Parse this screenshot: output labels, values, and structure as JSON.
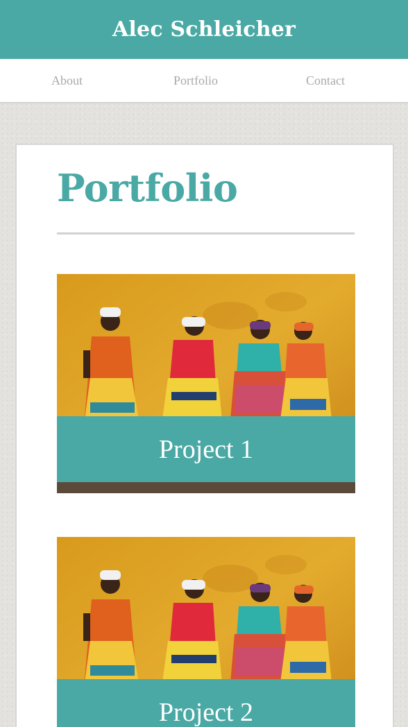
{
  "header": {
    "site_title": "Alec Schleicher",
    "accent_color": "#4aa9a5"
  },
  "nav": {
    "items": [
      {
        "label": "About"
      },
      {
        "label": "Portfolio"
      },
      {
        "label": "Contact"
      }
    ]
  },
  "main": {
    "page_title": "Portfolio",
    "projects": [
      {
        "label": "Project 1",
        "image": "photo of four women in colorful traditional dresses against an orange wall"
      },
      {
        "label": "Project 2",
        "image": "photo of four women in colorful traditional dresses against an orange wall"
      }
    ]
  }
}
